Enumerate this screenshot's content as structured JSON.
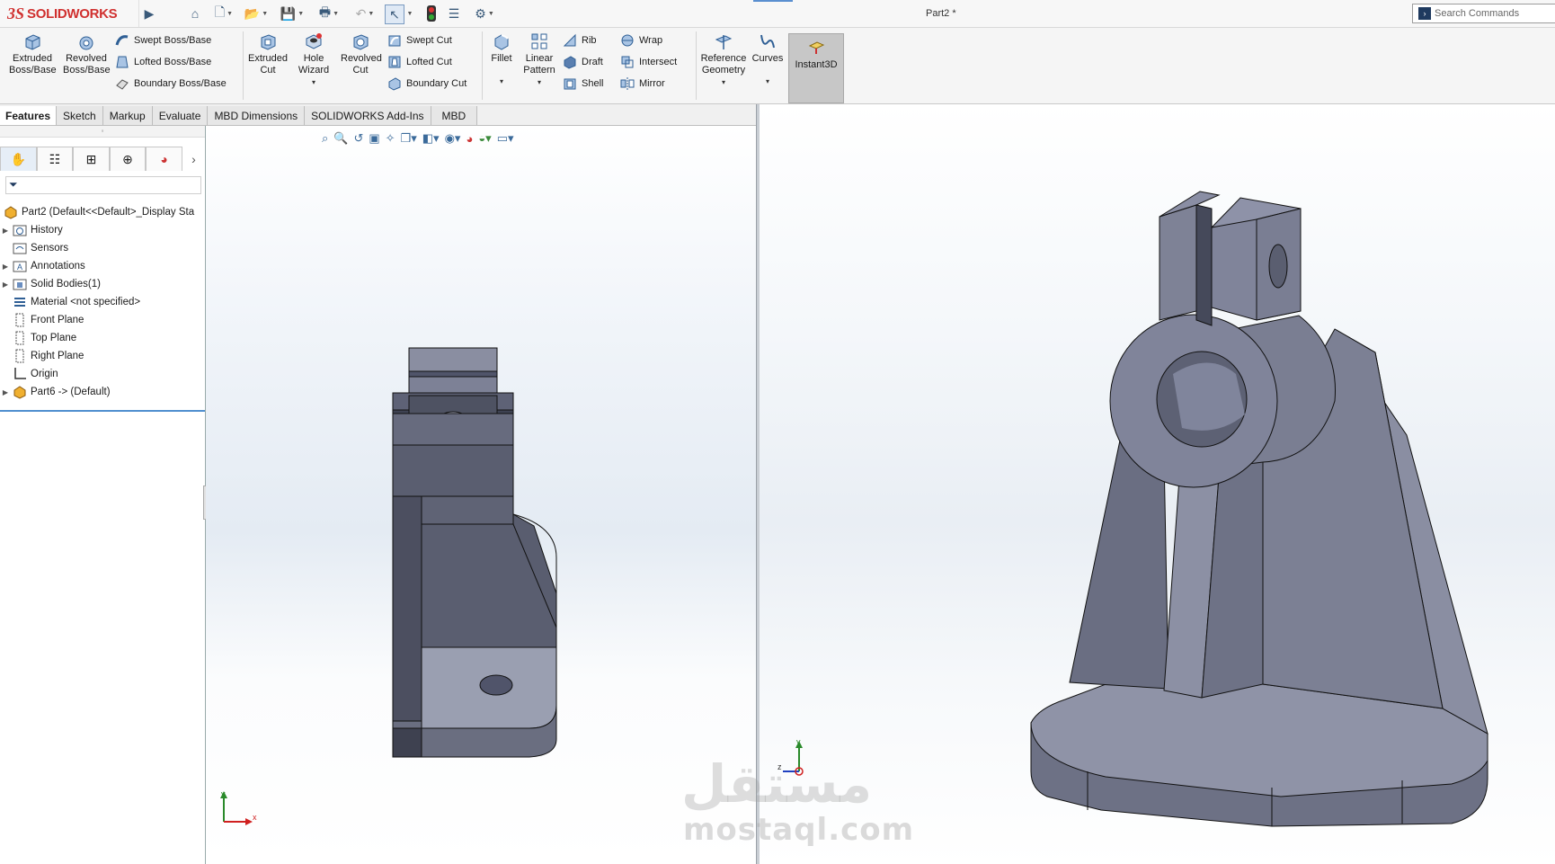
{
  "app": {
    "brand_ds": "3S",
    "brand_name": "SOLIDWORKS"
  },
  "title_bar": {
    "document_title": "Part2 *",
    "search_placeholder": "Search Commands"
  },
  "command_manager": {
    "extruded_boss": "Extruded Boss/Base",
    "revolved_boss": "Revolved Boss/Base",
    "swept_boss": "Swept Boss/Base",
    "lofted_boss": "Lofted Boss/Base",
    "boundary_boss": "Boundary Boss/Base",
    "extruded_cut": "Extruded Cut",
    "hole_wizard": "Hole Wizard",
    "revolved_cut": "Revolved Cut",
    "swept_cut": "Swept Cut",
    "lofted_cut": "Lofted Cut",
    "boundary_cut": "Boundary Cut",
    "fillet": "Fillet",
    "linear_pattern": "Linear Pattern",
    "rib": "Rib",
    "draft": "Draft",
    "shell": "Shell",
    "wrap": "Wrap",
    "intersect": "Intersect",
    "mirror": "Mirror",
    "reference_geometry": "Reference Geometry",
    "curves": "Curves",
    "instant3d": "Instant3D"
  },
  "tabs": [
    "Features",
    "Sketch",
    "Markup",
    "Evaluate",
    "MBD Dimensions",
    "SOLIDWORKS Add-Ins",
    "MBD"
  ],
  "feature_tree": {
    "root": "Part2  (Default<<Default>_Display Sta",
    "items": [
      {
        "label": "History",
        "expandable": true,
        "icon": "history-folder-icon"
      },
      {
        "label": "Sensors",
        "expandable": false,
        "icon": "sensors-icon"
      },
      {
        "label": "Annotations",
        "expandable": true,
        "icon": "annotations-icon"
      },
      {
        "label": "Solid Bodies(1)",
        "expandable": true,
        "icon": "solid-bodies-icon"
      },
      {
        "label": "Material <not specified>",
        "expandable": false,
        "icon": "material-icon"
      },
      {
        "label": "Front Plane",
        "expandable": false,
        "icon": "plane-icon"
      },
      {
        "label": "Top Plane",
        "expandable": false,
        "icon": "plane-icon"
      },
      {
        "label": "Right Plane",
        "expandable": false,
        "icon": "plane-icon"
      },
      {
        "label": "Origin",
        "expandable": false,
        "icon": "origin-icon"
      },
      {
        "label": "Part6 -> (Default)",
        "expandable": true,
        "icon": "part-icon"
      }
    ]
  },
  "triad_left": {
    "x": "x",
    "y": "y"
  },
  "triad_right": {
    "z": "z",
    "y": "y"
  },
  "watermark": {
    "arabic": "مستقل",
    "latin": "mostaql.com"
  },
  "colors": {
    "model": "#80849a",
    "brand": "#d0302f",
    "selection": "#4f8fcf"
  }
}
